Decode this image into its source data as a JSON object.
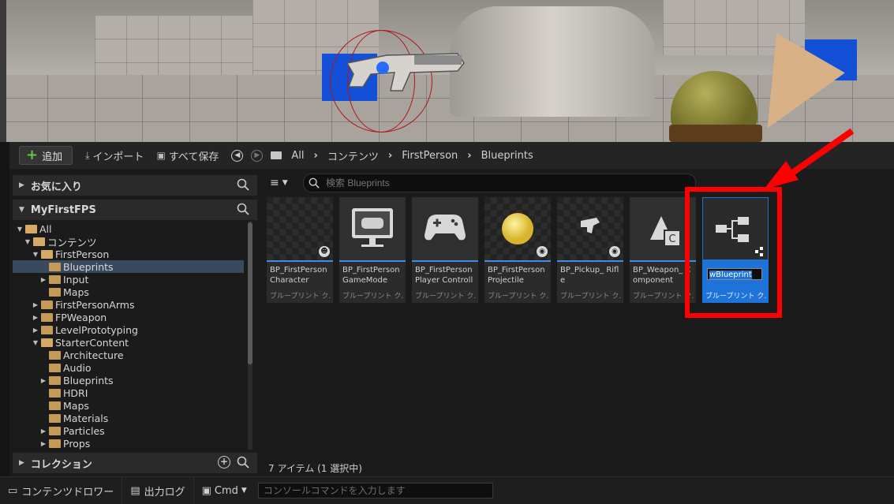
{
  "toolbar": {
    "add_label": "追加",
    "import_label": "インポート",
    "save_all_label": "すべて保存",
    "breadcrumb": [
      "All",
      "コンテンツ",
      "FirstPerson",
      "Blueprints"
    ]
  },
  "left_panel": {
    "favorites_label": "お気に入り",
    "project_label": "MyFirstFPS",
    "collections_label": "コレクション",
    "tree": [
      {
        "label": "All",
        "depth": 0,
        "expanded": true
      },
      {
        "label": "コンテンツ",
        "depth": 1,
        "expanded": true
      },
      {
        "label": "FirstPerson",
        "depth": 2,
        "expanded": true
      },
      {
        "label": "Blueprints",
        "depth": 3,
        "selected": true
      },
      {
        "label": "Input",
        "depth": 3,
        "collapsed": true
      },
      {
        "label": "Maps",
        "depth": 3
      },
      {
        "label": "FirstPersonArms",
        "depth": 2,
        "collapsed": true
      },
      {
        "label": "FPWeapon",
        "depth": 2,
        "collapsed": true
      },
      {
        "label": "LevelPrototyping",
        "depth": 2,
        "collapsed": true
      },
      {
        "label": "StarterContent",
        "depth": 2,
        "expanded": true
      },
      {
        "label": "Architecture",
        "depth": 3
      },
      {
        "label": "Audio",
        "depth": 3
      },
      {
        "label": "Blueprints",
        "depth": 3,
        "collapsed": true
      },
      {
        "label": "HDRI",
        "depth": 3
      },
      {
        "label": "Maps",
        "depth": 3
      },
      {
        "label": "Materials",
        "depth": 3
      },
      {
        "label": "Particles",
        "depth": 3,
        "collapsed": true
      },
      {
        "label": "Props",
        "depth": 3,
        "collapsed": true
      }
    ]
  },
  "search": {
    "placeholder": "検索 Blueprints"
  },
  "assets": [
    {
      "name": "BP_FirstPerson Character",
      "type": "ブループリント ク..."
    },
    {
      "name": "BP_FirstPerson GameMode",
      "type": "ブループリント ク..."
    },
    {
      "name": "BP_FirstPerson Player Controller",
      "type": "ブループリント ク..."
    },
    {
      "name": "BP_FirstPerson Projectile",
      "type": "ブループリント ク..."
    },
    {
      "name": "BP_Pickup_ Rifle",
      "type": "ブループリント ク..."
    },
    {
      "name": "BP_Weapon_ Component",
      "type": "ブループリント ク..."
    },
    {
      "name": "wBlueprint",
      "type": "ブループリント ク...",
      "selected": true,
      "renaming": true
    }
  ],
  "status": {
    "item_count": "7 アイテム (1 選択中)"
  },
  "bottom_bar": {
    "content_drawer": "コンテンツドロワー",
    "output_log": "出力ログ",
    "cmd": "Cmd",
    "console_placeholder": "コンソールコマンドを入力します"
  },
  "colors": {
    "accent": "#1e73d8",
    "highlight": "#ff0000",
    "add_green": "#5fc74c",
    "folder": "#c59a56"
  }
}
